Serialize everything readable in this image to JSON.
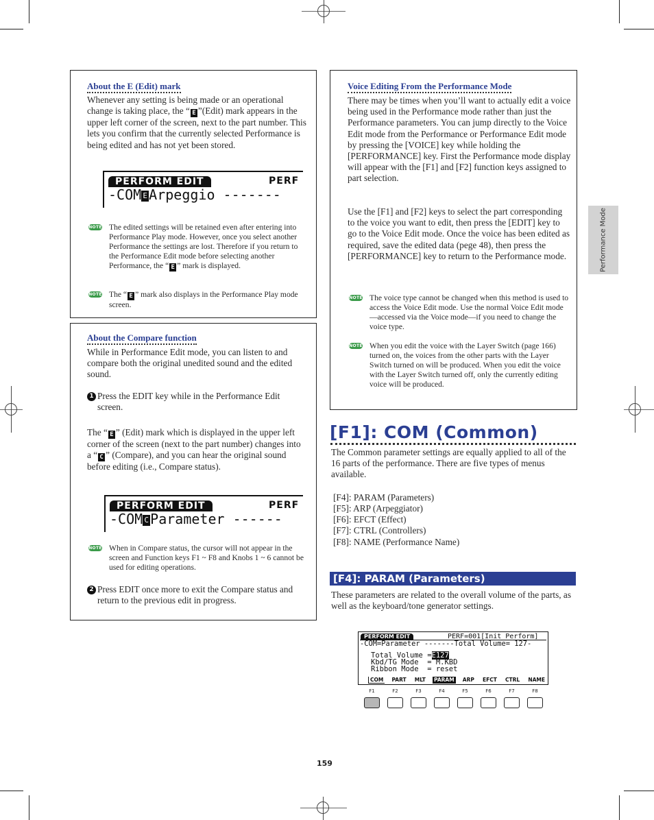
{
  "page_number": "159",
  "side_tab": "Performance Mode",
  "left_box_edit": {
    "title": "About the E (Edit) mark",
    "paragraph_parts": [
      "Whenever any setting is being made or an operational change is taking place, the “",
      "”(Edit) mark appears in the upper left corner of the screen, next to the part number. This lets you confirm that the currently selected Performance is being edited and has not yet been stored."
    ],
    "lcd": {
      "tab": "PERFORM EDIT",
      "right": "PERF",
      "line_prefix": "-COM",
      "mark": "E",
      "line_suffix": "Arpeggio -------"
    },
    "notes": [
      {
        "icon": "NOTE",
        "parts": [
          "The edited settings will be retained even after entering into Performance Play mode. However, once you select another Performance the settings are lost. Therefore if you return to the Performance Edit mode before selecting another Performance, the “",
          "” mark is displayed."
        ]
      },
      {
        "icon": "NOTE",
        "parts": [
          "The “",
          "” mark also displays in the Performance Play mode screen."
        ]
      }
    ],
    "mark_glyph": "E"
  },
  "left_box_compare": {
    "title": "About the Compare function",
    "intro": "While in Performance Edit mode, you can listen to and compare both the original unedited sound and the edited sound.",
    "step1_num": "1",
    "step1": "Press the EDIT key while in the Performance Edit screen.",
    "para_parts": [
      "The “",
      "” (Edit) mark which is displayed in the upper left corner of the screen (next to the part number) changes into a “",
      "” (Compare), and you can hear the original sound before editing (i.e., Compare status)."
    ],
    "edit_glyph": "E",
    "compare_glyph": "C",
    "lcd": {
      "tab": "PERFORM EDIT",
      "right": "PERF",
      "line_prefix": "-COM",
      "mark": "C",
      "line_suffix": "Parameter ------"
    },
    "note": {
      "icon": "NOTE",
      "text": "When in Compare status, the cursor will not appear in the screen and Function keys F1 ~ F8 and Knobs 1 ~ 6 cannot be used for editing operations."
    },
    "step2_num": "2",
    "step2": "Press EDIT once more to exit the Compare status and return to the previous edit in progress."
  },
  "right_box_voice": {
    "title": "Voice Editing From the Performance Mode",
    "para1": "There may be times when you’ll want to actually edit a voice being used in the Performance mode rather than just the Performance parameters. You can jump directly to the Voice Edit mode from the Performance or Performance Edit mode by pressing the [VOICE] key while holding the [PERFORMANCE] key. First the Performance mode display will appear with the [F1] and [F2] function keys assigned to part selection.",
    "para2": "Use the [F1] and [F2] keys to select the part corresponding to the voice you want to edit, then press the [EDIT] key to go to the Voice Edit mode. Once the voice has been edited as required, save the edited data (pege 48), then press the [PERFORMANCE] key to return to the Performance mode.",
    "notes": [
      {
        "icon": "NOTE",
        "text": "The voice type cannot be changed when this method is used to access the Voice Edit mode. Use the normal Voice Edit mode—accessed via the Voice mode—if you need to change the voice type."
      },
      {
        "icon": "NOTE",
        "text": "When you edit the voice with the Layer Switch (page 166) turned on, the voices from the other parts with the Layer Switch turned on will be produced. When you edit the voice with the Layer Switch turned off, only the currently editing voice will be produced."
      }
    ]
  },
  "section_com": {
    "heading": "[F1]: COM (Common)",
    "intro": "The Common parameter settings are equally applied to all of the 16 parts of the performance. There are five types of menus available.",
    "menu_list": [
      "[F4]: PARAM (Parameters)",
      "[F5]: ARP (Arpeggiator)",
      "[F6]: EFCT (Effect)",
      "[F7]: CTRL (Controllers)",
      "[F8]: NAME (Performance Name)"
    ]
  },
  "section_param": {
    "heading": "[F4]: PARAM (Parameters)",
    "intro": "These parameters are related to the overall volume of the parts, as well as the keyboard/tone generator settings.",
    "screen": {
      "tab": "PERFORM EDIT",
      "header_right": "PERF=001[Init Perform]",
      "title_line": "-COM=Parameter -------Total Volume= 127-",
      "rows": [
        {
          "label": "Total Volume",
          "eq": "=",
          "mark": "E",
          "value": "127"
        },
        {
          "label": "Kbd/TG Mode ",
          "eq": "= ",
          "mark": "",
          "value": "M.KBD"
        },
        {
          "label": "Ribbon Mode ",
          "eq": "= ",
          "mark": "",
          "value": "reset"
        }
      ],
      "menu": [
        "COM",
        "PART",
        "MLT",
        "PARAM",
        "ARP",
        "EFCT",
        "CTRL",
        "NAME"
      ],
      "menu_selected": "PARAM"
    },
    "fkeys": [
      "F1",
      "F2",
      "F3",
      "F4",
      "F5",
      "F6",
      "F7",
      "F8"
    ],
    "fkey_active": "F1"
  }
}
